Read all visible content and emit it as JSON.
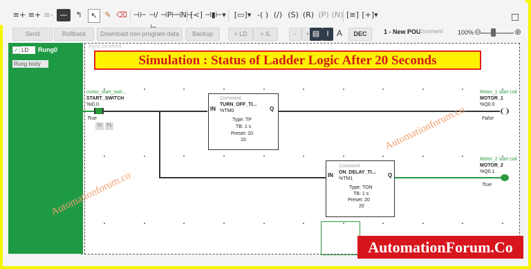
{
  "toolbar": {
    "icons": [
      "insert-rung-icon",
      "insert-rung-below-icon",
      "branch-icon",
      "wire-icon",
      "jump-icon",
      "pointer-icon",
      "pencil-icon",
      "eraser-icon",
      "no-contact-icon",
      "nc-contact-icon",
      "rising-contact-icon",
      "falling-contact-icon",
      "compare-block-icon",
      "coil-select-icon",
      "function-block-icon",
      "coil-icon",
      "negated-coil-icon",
      "set-coil-icon",
      "reset-coil-icon",
      "pulse-coil-icon",
      "operate-block-icon",
      "add-block-icon",
      "expand-icon"
    ]
  },
  "actions": {
    "send": "Send",
    "rollback": "Rollback",
    "download": "Download non-program data",
    "backup": "Backup",
    "to_ld": "> LD",
    "to_il": "> IL",
    "dec": "DEC"
  },
  "pou": {
    "title": "1 - New POU",
    "comment": "Comment"
  },
  "zoom": {
    "value": "100%"
  },
  "rung": {
    "lang": "LD",
    "name": "Rung0",
    "body_select": "Rung body",
    "comment": "Rung comment"
  },
  "banner": "Simulation : Status of Ladder Logic After 20 Seconds",
  "contact": {
    "comment": "motor_start_swit...",
    "name": "START_SWITCH",
    "address": "%I0.0",
    "state": "True",
    "force_t": "T0",
    "force_f": "F1"
  },
  "timer1": {
    "comment": "Comment",
    "name": "TURN_OFF_TI...",
    "address": "%TM0",
    "in": "IN",
    "q": "Q",
    "type": "Type: TP",
    "tb": "TB: 1 s",
    "preset": "Preset: 10",
    "current": "10"
  },
  "timer2": {
    "comment": "Comment",
    "name": "ON_DELAY_TI...",
    "address": "%TM1",
    "in": "IN",
    "q": "Q",
    "type": "Type: TON",
    "tb": "TB: 1 s",
    "preset": "Preset: 20",
    "current": "20"
  },
  "coil1": {
    "comment": "Motor_1 start coil",
    "name": "MOTOR_1",
    "address": "%Q0.0",
    "state": "False"
  },
  "coil2": {
    "comment": "Motor_2 start coil",
    "name": "MOTOR_2",
    "address": "%Q0.1",
    "state": "True"
  },
  "watermark": "Automationforum.co",
  "brand": "AutomationForum.Co",
  "colors": {
    "accent_green": "#1f9a44",
    "banner_red": "#d11a1a",
    "banner_yellow": "#fff200",
    "frame_yellow": "#f5f500"
  }
}
